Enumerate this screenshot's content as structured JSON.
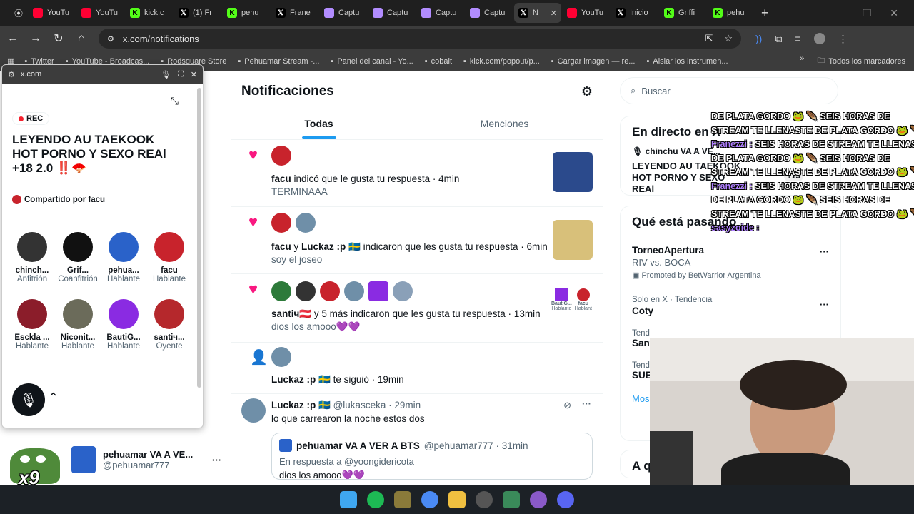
{
  "browser": {
    "tabs": [
      {
        "label": "YouTu",
        "icon": "youtube-icon",
        "color": "#ff0033"
      },
      {
        "label": "YouTu",
        "icon": "youtube-icon",
        "color": "#ff0033"
      },
      {
        "label": "kick.c",
        "icon": "kick-icon",
        "color": "#53fc18"
      },
      {
        "label": "(1) Fr",
        "icon": "x-icon",
        "color": "#000000"
      },
      {
        "label": "pehu",
        "icon": "kick-icon",
        "color": "#53fc18"
      },
      {
        "label": "Frane",
        "icon": "x-icon",
        "color": "#000000"
      },
      {
        "label": "Captu",
        "icon": "pen-icon",
        "color": "#b28cff"
      },
      {
        "label": "Captu",
        "icon": "pen-icon",
        "color": "#b28cff"
      },
      {
        "label": "Captu",
        "icon": "pen-icon",
        "color": "#b28cff"
      },
      {
        "label": "Captu",
        "icon": "pen-icon",
        "color": "#b28cff"
      },
      {
        "label": "N",
        "icon": "x-icon",
        "color": "#000000",
        "active": true
      },
      {
        "label": "YouTu",
        "icon": "youtube-icon",
        "color": "#ff0033"
      },
      {
        "label": "Inicio",
        "icon": "x-icon",
        "color": "#000000"
      },
      {
        "label": "Griffi",
        "icon": "kick-icon",
        "color": "#53fc18"
      },
      {
        "label": "pehu",
        "icon": "kick-icon",
        "color": "#53fc18"
      }
    ],
    "url": "x.com/notifications",
    "bookmarks": [
      "Twitter",
      "YouTube - Broadcas...",
      "Rodsquare Store",
      "Pehuamar Stream -...",
      "Panel del canal - Yo...",
      "cobalt",
      "kick.com/popout/p...",
      "Cargar imagen — re...",
      "Aislar los instrumen..."
    ],
    "bookmarks_all": "Todos los marcadores"
  },
  "popup": {
    "url": "x.com",
    "rec": "REC",
    "title": "LEYENDO AU TAEKOOK HOT PORNO Y SEXO REAl +18 2.0 ‼️🪭",
    "shared_by": "Compartido por facu",
    "participants": [
      {
        "name": "chinch...",
        "role": "Anfitrión",
        "color": "#333333"
      },
      {
        "name": "Grif...",
        "role": "Coanfitrión",
        "color": "#111111"
      },
      {
        "name": "pehua...",
        "role": "Hablante",
        "color": "#2a62c9"
      },
      {
        "name": "facu",
        "role": "Hablante",
        "color": "#c8232c"
      },
      {
        "name": "Esckla ...",
        "role": "Hablante",
        "color": "#8b1d2a"
      },
      {
        "name": "Niconit...",
        "role": "Hablante",
        "color": "#6b6b5a"
      },
      {
        "name": "BautiG...",
        "role": "Hablante",
        "color": "#8a2be2"
      },
      {
        "name": "santiч...",
        "role": "Oyente",
        "color": "#b5282c"
      }
    ]
  },
  "sidebar_account": {
    "name": "pehuamar VA A VE...",
    "handle": "@pehuamar777"
  },
  "notifications": {
    "title": "Notificaciones",
    "tabs": [
      "Todas",
      "Menciones"
    ],
    "items": [
      {
        "text_bold": "facu",
        "text": " indicó que le gusta tu respuesta · 4min",
        "sub": "TERMINAAA"
      },
      {
        "text_bold": "facu",
        "text_mid": " y ",
        "text_bold2": "Luckaz :p 🇸🇪",
        "text": " indicaron que les gusta tu respuesta · 6min",
        "sub": "soy el joseo"
      },
      {
        "text_bold": "santiч🇦🇹",
        "text": " y 5 más indicaron que les gusta tu respuesta · 13min",
        "sub": "dios los amooo💜💜"
      },
      {
        "text_bold": "Luckaz :p 🇸🇪",
        "text": " te siguió · 19min"
      }
    ],
    "tweet": {
      "name": "Luckaz :p 🇸🇪",
      "handle": "@lukasceka · 29min",
      "body": "lo que carrearon la noche estos dos",
      "quote_name": "pehuamar VA A VER A BTS",
      "quote_handle": "@pehuamar777 · 31min",
      "quote_reply": "En respuesta a @yoongidericota",
      "quote_body": "dios los amooo💜💜"
    },
    "thumb3_names": [
      "BautiG...",
      "facu"
    ],
    "thumb3_roles": [
      "Hablante",
      "Hablant"
    ]
  },
  "right": {
    "search_placeholder": "Buscar",
    "live_title": "En directo en X",
    "live_host": "chinchu VA A VE...",
    "live_space": "LEYENDO AU TAEKOOK HOT PORNO Y SEXO REAl",
    "live_count": "+13",
    "happening_title": "Qué está pasando",
    "trends": [
      {
        "title": "TorneoApertura",
        "sub": "RIV vs. BOCA",
        "promo": "Promoted by BetWarrior Argentina"
      },
      {
        "context": "Solo en X · Tendencia",
        "title": "Coty"
      },
      {
        "context": "Tend",
        "title": "Sant"
      },
      {
        "context": "Tend",
        "title": "SUB"
      }
    ],
    "more": "Mos",
    "next_section": "A q"
  },
  "chat_overlay": [
    {
      "user": "",
      "msg": "DE PLATA GORDO 🐸 🪶 SEIS HORAS DE"
    },
    {
      "user": "",
      "msg": "STREAM TE LLENASTE DE PLATA GORDO 🐸 🪶"
    },
    {
      "user": "Franezzi :",
      "msg": "SEIS HORAS DE STREAM TE LLENASTE"
    },
    {
      "user": "",
      "msg": "DE PLATA GORDO 🐸 🪶 SEIS HORAS DE"
    },
    {
      "user": "",
      "msg": "STREAM TE LLENASTE DE PLATA GORDO 🐸 🪶"
    },
    {
      "user": "Franezzi :",
      "msg": "SEIS HORAS DE STREAM TE LLENASTE"
    },
    {
      "user": "",
      "msg": "DE PLATA GORDO 🐸 🪶 SEIS HORAS DE"
    },
    {
      "user": "",
      "msg": "STREAM TE LLENASTE DE PLATA GORDO 🐸 🪶"
    },
    {
      "user": "sasyzoide :",
      "msg": ""
    }
  ],
  "emote_label": "x9"
}
